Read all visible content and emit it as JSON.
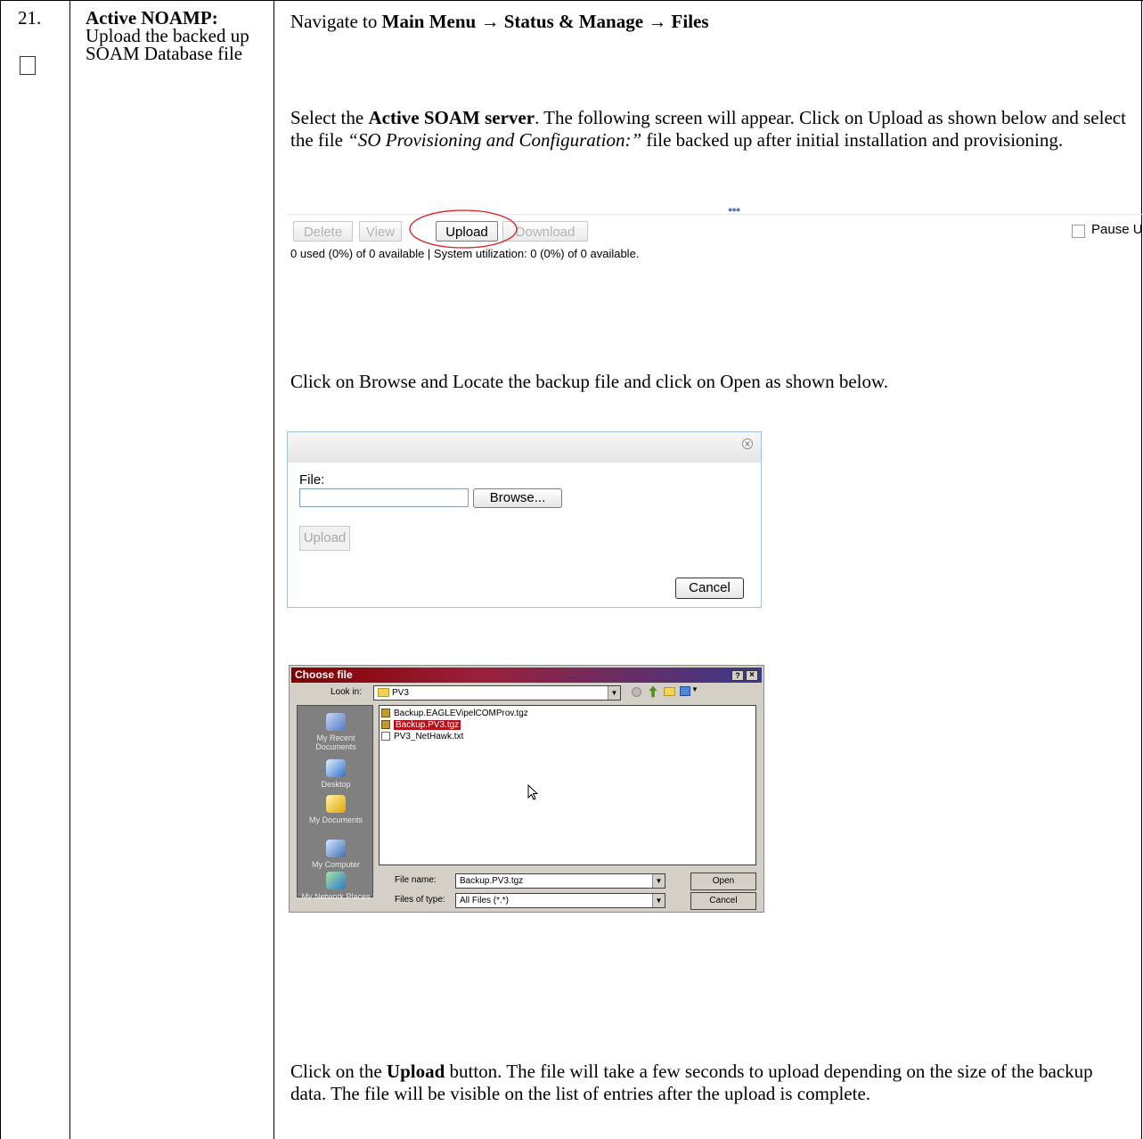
{
  "step": {
    "number": "21.",
    "title": "Active NOAMP:",
    "description": "Upload the backed up SOAM Database file"
  },
  "nav": {
    "prefix": "Navigate to ",
    "path": "Main Menu → Status & Manage → Files"
  },
  "para1": {
    "t1": "Select the ",
    "b1": "Active SOAM server",
    "t2": ". The following screen will appear. Click on Upload as shown below and select the file ",
    "i1": "“SO Provisioning and Configuration:”",
    "t3": " file backed up after initial installation and provisioning."
  },
  "toolbar": {
    "buttons": [
      "Delete",
      "View",
      "Upload",
      "Download"
    ],
    "pause_label": "Pause U",
    "status": "0 used (0%) of 0 available | System utilization: 0 (0%) of 0 available."
  },
  "para2": "Click on Browse and Locate the backup file and click on Open as shown below.",
  "upload_dialog": {
    "file_label": "File:",
    "browse": "Browse...",
    "upload": "Upload",
    "cancel": "Cancel"
  },
  "file_chooser": {
    "title": "Choose file",
    "look_in_label": "Look in:",
    "look_in_value": "PV3",
    "places": [
      "My Recent Documents",
      "Desktop",
      "My Documents",
      "My Computer",
      "My Network Places"
    ],
    "files": [
      "Backup.EAGLEVipelCOMProv.tgz",
      "Backup.PV3.tgz",
      "PV3_NetHawk.txt"
    ],
    "file_name_label": "File name:",
    "file_name_value": "Backup.PV3.tgz",
    "file_type_label": "Files of type:",
    "file_type_value": "All Files (*.*)",
    "open": "Open",
    "cancel": "Cancel"
  },
  "para3": {
    "t1": "Click on the ",
    "b1": "Upload",
    "t2": " button. The file will take a few seconds to upload depending on the size of the backup data. The file will be visible on the list of entries after the upload is complete."
  },
  "colors": {
    "highlight_circle": "#d81e1e",
    "selected_file_bg": "#b5121b",
    "dialog_border": "#9dc3e6"
  }
}
